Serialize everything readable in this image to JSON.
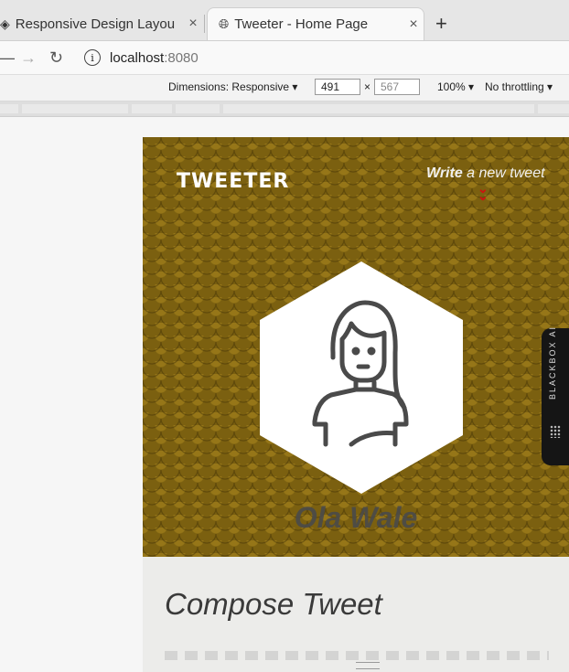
{
  "browser": {
    "tabs": [
      {
        "title": "Responsive Design Layou",
        "active": false
      },
      {
        "title": "Tweeter - Home Page",
        "active": true
      }
    ],
    "new_tab": "+",
    "close": "×",
    "url_host": "localhost",
    "url_port": ":8080"
  },
  "devtools": {
    "dimensions_label": "Dimensions: Responsive",
    "width": "491",
    "times": "×",
    "height": "567",
    "zoom": "100%",
    "throttling": "No throttling"
  },
  "app": {
    "logo": "TWEETER",
    "write_bold": "Write",
    "write_rest": " a new tweet",
    "username": "Ola Wale",
    "compose_title": "Compose Tweet"
  },
  "extension": {
    "label": "BLACKBOX AI"
  },
  "colors": {
    "hero_bg": "#7b6010",
    "arrow": "#d01010",
    "title_text": "#3a3a3a"
  }
}
